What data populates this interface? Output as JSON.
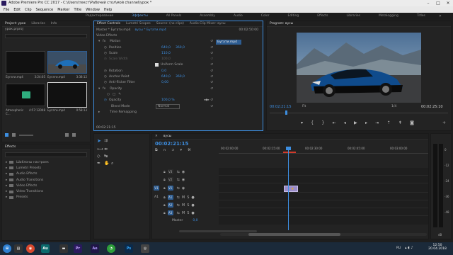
{
  "window": {
    "title": "Adobe Premiere Pro CC 2017 - C:\\Users\\текст\\Рабочий стол\\мой channel\\урок *",
    "minimize": "–",
    "maximize": "□",
    "close": "✕"
  },
  "menu": [
    "File",
    "Edit",
    "Clip",
    "Sequence",
    "Marker",
    "Title",
    "Window",
    "Help"
  ],
  "workspaces": [
    "Редактирование",
    "Эффекты",
    "All Panels",
    "Assembly",
    "Audio",
    "Color",
    "Editing",
    "Effects",
    "Libraries",
    "Metalogging",
    "Titles"
  ],
  "project": {
    "tabs": [
      "Project: урок",
      "Libraries",
      "Info"
    ],
    "search_label": "урок.prproj",
    "items": [
      {
        "name": "Бугати.mp4",
        "duration": "3:24:05"
      },
      {
        "name": "Бугати.mp4",
        "duration": "3:38:12"
      },
      {
        "name": "Atmospheric C...",
        "duration": "4:57:12048"
      },
      {
        "name": "Бугати.mp4",
        "duration": "0:58:13"
      }
    ]
  },
  "effect_controls": {
    "tabs": [
      "Effect Controls",
      "Lumetri Scopes",
      "Source: (no clips)",
      "Audio Clip Mixer: вусы"
    ],
    "clip_selector": "Master * Бугати.mp4",
    "clip_selector2": "вусы * Бугати.mp4",
    "timecode_ruler": "00:02:50:00",
    "section": "Video Effects",
    "clip_bar": "Бугати.mp4",
    "params": [
      {
        "name": "Motion",
        "value": "",
        "value2": ""
      },
      {
        "name": "Position",
        "value": "640,0",
        "value2": "360,0"
      },
      {
        "name": "Scale",
        "value": "110,0",
        "value2": ""
      },
      {
        "name": "Scale Width",
        "value": "100,0",
        "value2": ""
      },
      {
        "name": "Uniform Scale",
        "value": "",
        "value2": ""
      },
      {
        "name": "Rotation",
        "value": "0,0",
        "value2": ""
      },
      {
        "name": "Anchor Point",
        "value": "640,0",
        "value2": "360,0"
      },
      {
        "name": "Anti-flicker Filter",
        "value": "0,00",
        "value2": ""
      },
      {
        "name": "Opacity",
        "value": "",
        "value2": ""
      },
      {
        "name": "",
        "value": "",
        "value2": ""
      },
      {
        "name": "Opacity",
        "value": "100,0 %",
        "value2": ""
      },
      {
        "name": "Blend Mode",
        "value": "Normal",
        "value2": ""
      },
      {
        "name": "Time Remapping",
        "value": "",
        "value2": ""
      }
    ],
    "footer_timecode": "00:02:21:15"
  },
  "program": {
    "title": "Program: вусы",
    "timecode_left": "00:02:21:15",
    "fit": "Fit",
    "ratio": "1/4",
    "timecode_right": "00:02:25:10"
  },
  "effects": {
    "title": "Effects",
    "items": [
      "Шаблоны настроек",
      "Lumetri Presets",
      "Audio Effects",
      "Audio Transitions",
      "Video Effects",
      "Video Transitions",
      "Presets"
    ]
  },
  "timeline": {
    "tab": "вусы",
    "timecode": "00:02:21:15",
    "ruler": [
      "00:02:00:00",
      "00:02:15:00",
      "00:02:30:00",
      "00:02:45:00",
      "00:03:00:00"
    ],
    "video_tracks": [
      "V3",
      "V2",
      "V1"
    ],
    "audio_tracks": [
      "A1",
      "A2",
      "A3"
    ],
    "side_labels": [
      "V1",
      "A1"
    ],
    "master": "Master",
    "master_value": "0,0",
    "db_labels": [
      "0",
      "-12",
      "-24",
      "-36",
      "-48",
      "dB"
    ]
  },
  "taskbar": {
    "apps": [
      "Au",
      "Pr",
      "Ae",
      "Ps"
    ],
    "lang": "RU",
    "time": "12:50",
    "date": "20.04.2018"
  },
  "colors": {
    "accent": "#3d8ee0",
    "selection": "#2e5d92",
    "playhead": "#3d8ee0",
    "mark_red": "#d23a2a"
  }
}
